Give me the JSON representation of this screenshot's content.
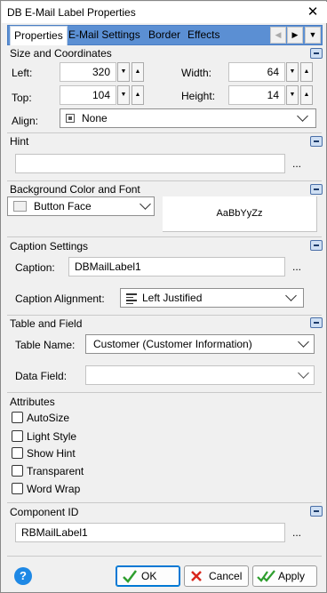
{
  "window": {
    "title": "DB E-Mail Label Properties"
  },
  "tabs": [
    {
      "label": "Properties"
    },
    {
      "label": "E-Mail Settings"
    },
    {
      "label": "Border"
    },
    {
      "label": "Effects"
    }
  ],
  "size": {
    "title": "Size and Coordinates",
    "left_label": "Left:",
    "left_value": "320",
    "top_label": "Top:",
    "top_value": "104",
    "width_label": "Width:",
    "width_value": "64",
    "height_label": "Height:",
    "height_value": "14",
    "align_label": "Align:",
    "align_value": "None"
  },
  "hint": {
    "title": "Hint",
    "value": "",
    "ellipsis": "..."
  },
  "background": {
    "title": "Background Color and Font",
    "color_value": "Button Face",
    "font_sample": "AaBbYyZz"
  },
  "caption": {
    "title": "Caption Settings",
    "caption_label": "Caption:",
    "caption_value": "DBMailLabel1",
    "ellipsis": "...",
    "alignment_label": "Caption Alignment:",
    "alignment_value": "Left Justified"
  },
  "table_field": {
    "title": "Table and Field",
    "table_label": "Table Name:",
    "table_value": "Customer  (Customer Information)",
    "field_label": "Data Field:",
    "field_value": ""
  },
  "attributes": {
    "title": "Attributes",
    "items": [
      {
        "label": "AutoSize",
        "checked": false
      },
      {
        "label": "Light Style",
        "checked": false
      },
      {
        "label": "Show Hint",
        "checked": false
      },
      {
        "label": "Transparent",
        "checked": false
      },
      {
        "label": "Word Wrap",
        "checked": false
      }
    ]
  },
  "component": {
    "title": "Component ID",
    "value": "RBMailLabel1",
    "ellipsis": "..."
  },
  "buttons": {
    "help": "?",
    "ok": "OK",
    "cancel": "Cancel",
    "apply": "Apply"
  },
  "colors": {
    "tab_bar": "#5b8fd3",
    "ok_check": "#2e9e2e",
    "cancel_x": "#d9261c",
    "help_circle": "#1e88e5"
  }
}
